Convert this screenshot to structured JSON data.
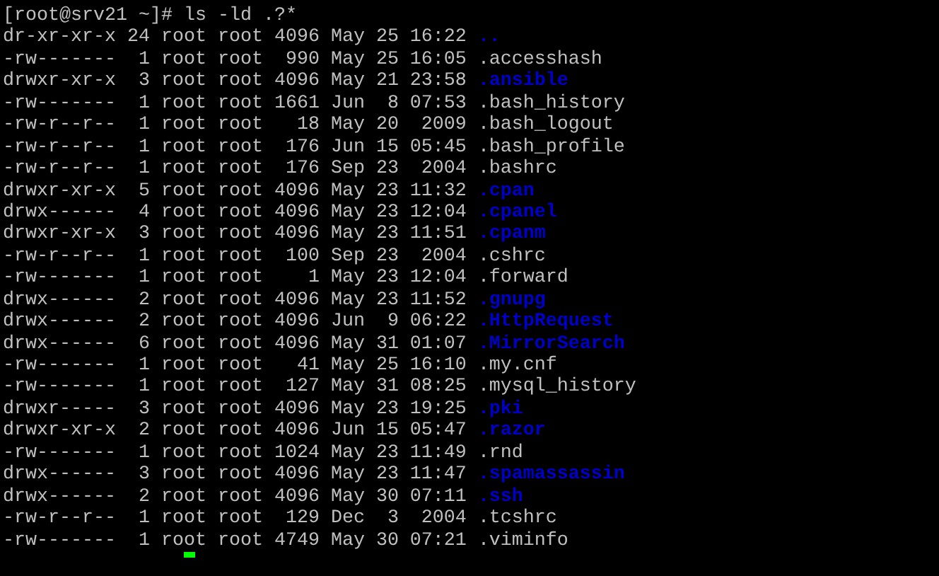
{
  "terminal": {
    "prompt": "[root@srv21 ~]# ls -ld .?*",
    "entries": [
      {
        "mode": "dr-xr-xr-x",
        "links": "24",
        "owner": "root",
        "group": "root",
        "size": "4096",
        "date": "May 25 16:22",
        "name": "..",
        "kind": "dir"
      },
      {
        "mode": "-rw-------",
        "links": "1",
        "owner": "root",
        "group": "root",
        "size": "990",
        "date": "May 25 16:05",
        "name": ".accesshash",
        "kind": "file"
      },
      {
        "mode": "drwxr-xr-x",
        "links": "3",
        "owner": "root",
        "group": "root",
        "size": "4096",
        "date": "May 21 23:58",
        "name": ".ansible",
        "kind": "dir"
      },
      {
        "mode": "-rw-------",
        "links": "1",
        "owner": "root",
        "group": "root",
        "size": "1661",
        "date": "Jun  8 07:53",
        "name": ".bash_history",
        "kind": "file"
      },
      {
        "mode": "-rw-r--r--",
        "links": "1",
        "owner": "root",
        "group": "root",
        "size": "18",
        "date": "May 20  2009",
        "name": ".bash_logout",
        "kind": "file"
      },
      {
        "mode": "-rw-r--r--",
        "links": "1",
        "owner": "root",
        "group": "root",
        "size": "176",
        "date": "Jun 15 05:45",
        "name": ".bash_profile",
        "kind": "file"
      },
      {
        "mode": "-rw-r--r--",
        "links": "1",
        "owner": "root",
        "group": "root",
        "size": "176",
        "date": "Sep 23  2004",
        "name": ".bashrc",
        "kind": "file"
      },
      {
        "mode": "drwxr-xr-x",
        "links": "5",
        "owner": "root",
        "group": "root",
        "size": "4096",
        "date": "May 23 11:32",
        "name": ".cpan",
        "kind": "dir"
      },
      {
        "mode": "drwx------",
        "links": "4",
        "owner": "root",
        "group": "root",
        "size": "4096",
        "date": "May 23 12:04",
        "name": ".cpanel",
        "kind": "dir"
      },
      {
        "mode": "drwxr-xr-x",
        "links": "3",
        "owner": "root",
        "group": "root",
        "size": "4096",
        "date": "May 23 11:51",
        "name": ".cpanm",
        "kind": "dir"
      },
      {
        "mode": "-rw-r--r--",
        "links": "1",
        "owner": "root",
        "group": "root",
        "size": "100",
        "date": "Sep 23  2004",
        "name": ".cshrc",
        "kind": "file"
      },
      {
        "mode": "-rw-------",
        "links": "1",
        "owner": "root",
        "group": "root",
        "size": "1",
        "date": "May 23 12:04",
        "name": ".forward",
        "kind": "file"
      },
      {
        "mode": "drwx------",
        "links": "2",
        "owner": "root",
        "group": "root",
        "size": "4096",
        "date": "May 23 11:52",
        "name": ".gnupg",
        "kind": "dir"
      },
      {
        "mode": "drwx------",
        "links": "2",
        "owner": "root",
        "group": "root",
        "size": "4096",
        "date": "Jun  9 06:22",
        "name": ".HttpRequest",
        "kind": "dir"
      },
      {
        "mode": "drwx------",
        "links": "6",
        "owner": "root",
        "group": "root",
        "size": "4096",
        "date": "May 31 01:07",
        "name": ".MirrorSearch",
        "kind": "dir"
      },
      {
        "mode": "-rw-------",
        "links": "1",
        "owner": "root",
        "group": "root",
        "size": "41",
        "date": "May 25 16:10",
        "name": ".my.cnf",
        "kind": "file"
      },
      {
        "mode": "-rw-------",
        "links": "1",
        "owner": "root",
        "group": "root",
        "size": "127",
        "date": "May 31 08:25",
        "name": ".mysql_history",
        "kind": "file"
      },
      {
        "mode": "drwxr-----",
        "links": "3",
        "owner": "root",
        "group": "root",
        "size": "4096",
        "date": "May 23 19:25",
        "name": ".pki",
        "kind": "dir"
      },
      {
        "mode": "drwxr-xr-x",
        "links": "2",
        "owner": "root",
        "group": "root",
        "size": "4096",
        "date": "Jun 15 05:47",
        "name": ".razor",
        "kind": "dir"
      },
      {
        "mode": "-rw-------",
        "links": "1",
        "owner": "root",
        "group": "root",
        "size": "1024",
        "date": "May 23 11:49",
        "name": ".rnd",
        "kind": "file"
      },
      {
        "mode": "drwx------",
        "links": "3",
        "owner": "root",
        "group": "root",
        "size": "4096",
        "date": "May 23 11:47",
        "name": ".spamassassin",
        "kind": "dir"
      },
      {
        "mode": "drwx------",
        "links": "2",
        "owner": "root",
        "group": "root",
        "size": "4096",
        "date": "May 30 07:11",
        "name": ".ssh",
        "kind": "dir"
      },
      {
        "mode": "-rw-r--r--",
        "links": "1",
        "owner": "root",
        "group": "root",
        "size": "129",
        "date": "Dec  3  2004",
        "name": ".tcshrc",
        "kind": "file"
      },
      {
        "mode": "-rw-------",
        "links": "1",
        "owner": "root",
        "group": "root",
        "size": "4749",
        "date": "May 30 07:21",
        "name": ".viminfo",
        "kind": "file"
      }
    ]
  }
}
